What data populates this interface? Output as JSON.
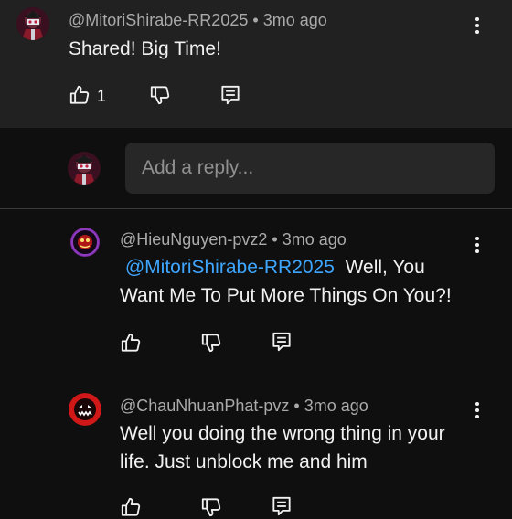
{
  "top_comment": {
    "author": "@MitoriShirabe-RR2025",
    "time": "3mo ago",
    "text": "Shared! Big Time!",
    "likes": "1"
  },
  "reply_box": {
    "placeholder": "Add a reply..."
  },
  "replies": [
    {
      "author": "@HieuNguyen-pvz2",
      "time": "3mo ago",
      "mention": "@MitoriShirabe-RR2025",
      "text_line1": "Well, You",
      "text_line2": "Want Me To Put More Things On You?!"
    },
    {
      "author": "@ChauNhuanPhat-pvz",
      "time": "3mo ago",
      "text_line1": "Well you doing the wrong thing in your",
      "text_line2": "life. Just unblock me and him"
    }
  ],
  "icons": {
    "like": "thumbs-up-icon",
    "dislike": "thumbs-down-icon",
    "reply": "reply-icon",
    "more": "kebab-menu-icon"
  },
  "colors": {
    "background": "#0f0f0f",
    "highlight_background": "#212121",
    "mention": "#3ea6ff",
    "meta_text": "#aaaaaa"
  },
  "separator": "•"
}
